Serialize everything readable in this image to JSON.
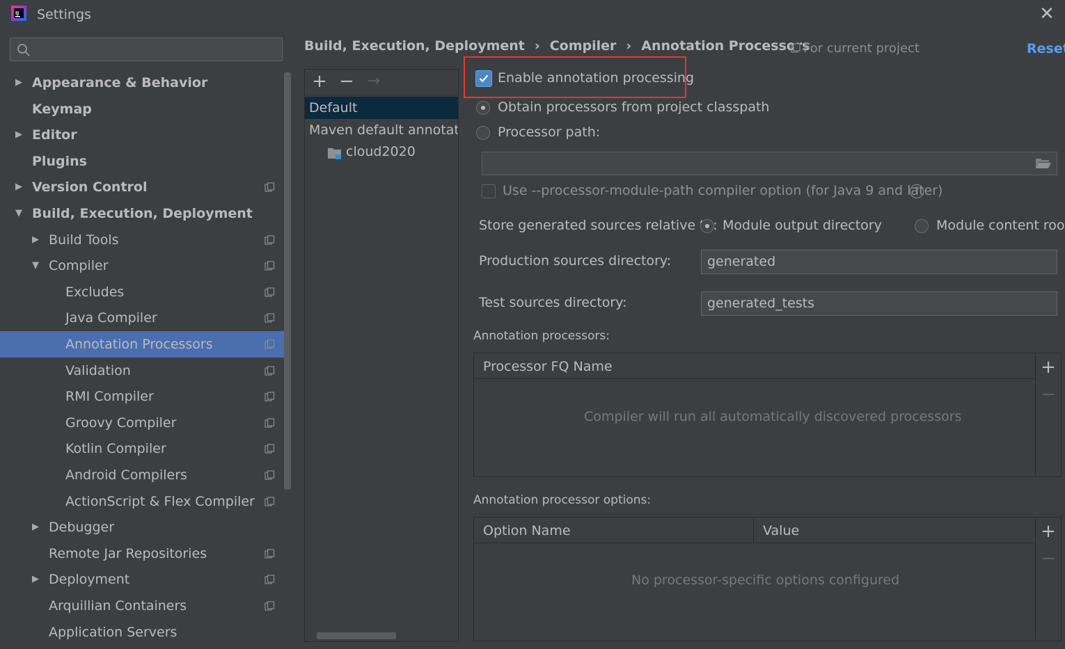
{
  "window": {
    "title": "Settings"
  },
  "search": {
    "placeholder": "",
    "value": ""
  },
  "sidebar": {
    "items": [
      {
        "label": "Appearance & Behavior",
        "level": 0,
        "arrow": "collapsed",
        "bold": true,
        "project_icon": false
      },
      {
        "label": "Keymap",
        "level": 0,
        "arrow": "none",
        "bold": true,
        "project_icon": false
      },
      {
        "label": "Editor",
        "level": 0,
        "arrow": "collapsed",
        "bold": true,
        "project_icon": false
      },
      {
        "label": "Plugins",
        "level": 0,
        "arrow": "none",
        "bold": true,
        "project_icon": false
      },
      {
        "label": "Version Control",
        "level": 0,
        "arrow": "collapsed",
        "bold": true,
        "project_icon": true
      },
      {
        "label": "Build, Execution, Deployment",
        "level": 0,
        "arrow": "expanded",
        "bold": true,
        "project_icon": false
      },
      {
        "label": "Build Tools",
        "level": 1,
        "arrow": "collapsed",
        "bold": false,
        "project_icon": true
      },
      {
        "label": "Compiler",
        "level": 1,
        "arrow": "expanded",
        "bold": false,
        "project_icon": true
      },
      {
        "label": "Excludes",
        "level": 2,
        "arrow": "none",
        "bold": false,
        "project_icon": true
      },
      {
        "label": "Java Compiler",
        "level": 2,
        "arrow": "none",
        "bold": false,
        "project_icon": true
      },
      {
        "label": "Annotation Processors",
        "level": 2,
        "arrow": "none",
        "bold": false,
        "project_icon": true,
        "selected": true
      },
      {
        "label": "Validation",
        "level": 2,
        "arrow": "none",
        "bold": false,
        "project_icon": true
      },
      {
        "label": "RMI Compiler",
        "level": 2,
        "arrow": "none",
        "bold": false,
        "project_icon": true
      },
      {
        "label": "Groovy Compiler",
        "level": 2,
        "arrow": "none",
        "bold": false,
        "project_icon": true
      },
      {
        "label": "Kotlin Compiler",
        "level": 2,
        "arrow": "none",
        "bold": false,
        "project_icon": true
      },
      {
        "label": "Android Compilers",
        "level": 2,
        "arrow": "none",
        "bold": false,
        "project_icon": true
      },
      {
        "label": "ActionScript & Flex Compiler",
        "level": 2,
        "arrow": "none",
        "bold": false,
        "project_icon": true
      },
      {
        "label": "Debugger",
        "level": 1,
        "arrow": "collapsed",
        "bold": false,
        "project_icon": false
      },
      {
        "label": "Remote Jar Repositories",
        "level": 1,
        "arrow": "none",
        "bold": false,
        "project_icon": true
      },
      {
        "label": "Deployment",
        "level": 1,
        "arrow": "collapsed",
        "bold": false,
        "project_icon": true
      },
      {
        "label": "Arquillian Containers",
        "level": 1,
        "arrow": "none",
        "bold": false,
        "project_icon": true
      },
      {
        "label": "Application Servers",
        "level": 1,
        "arrow": "none",
        "bold": false,
        "project_icon": false
      }
    ]
  },
  "breadcrumb": {
    "items": [
      "Build, Execution, Deployment",
      "Compiler",
      "Annotation Processors"
    ],
    "separator": "›"
  },
  "header": {
    "scope": "For current project",
    "reset": "Reset"
  },
  "profiles": {
    "toolbar": {
      "add": "+",
      "remove": "−",
      "move": "→"
    },
    "default": "Default",
    "maven": "Maven default annotation processors profile",
    "module": "cloud2020"
  },
  "settings": {
    "enable_label": "Enable annotation processing",
    "enable_checked": true,
    "obtain_label": "Obtain processors from project classpath",
    "processor_path_label": "Processor path:",
    "processor_path_value": "",
    "module_path_label": "Use --processor-module-path compiler option (for Java 9 and later)",
    "help": "?",
    "store_label": "Store generated sources relative to:",
    "module_output": "Module output directory",
    "module_content": "Module content root",
    "production_label": "Production sources directory:",
    "production_value": "generated",
    "test_label": "Test sources directory:",
    "test_value": "generated_tests"
  },
  "processors_table": {
    "title": "Annotation processors:",
    "column": "Processor FQ Name",
    "empty": "Compiler will run all automatically discovered processors",
    "add": "+",
    "remove": "−"
  },
  "options_table": {
    "title": "Annotation processor options:",
    "columns": [
      "Option Name",
      "Value"
    ],
    "empty": "No processor-specific options configured",
    "add": "+",
    "remove": "−"
  },
  "colors": {
    "background": "#3c3f41",
    "selection": "#4b6eaf",
    "accent_link": "#589df6",
    "highlight_border": "#e8352f",
    "checkbox": "#4a88c7"
  },
  "icons": [
    "app-logo-icon",
    "close-icon",
    "search-icon",
    "project-scope-icon",
    "folder-icon",
    "help-icon",
    "folder-open-icon"
  ]
}
